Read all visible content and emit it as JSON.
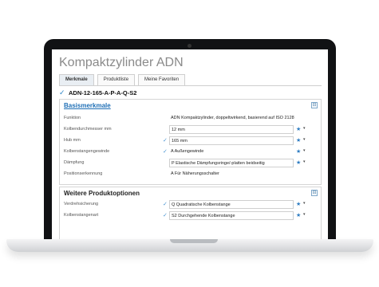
{
  "app": {
    "title": "Kompaktzylinder ADN"
  },
  "tabs": [
    {
      "label": "Merkmale"
    },
    {
      "label": "Produktliste"
    },
    {
      "label": "Meine Favoriten"
    }
  ],
  "product_code": "ADN-12-165-A-P-A-Q-S2",
  "sections": {
    "basis": {
      "title": "Basismerkmale",
      "collapse_symbol": "⊟",
      "rows": [
        {
          "label": "Funktion",
          "value": "ADN Kompaktzylinder, doppeltwirkend, basierend auf ISO 2128"
        },
        {
          "label": "Kolbendurchmesser mm",
          "value": "12 mm"
        },
        {
          "label": "Hub mm",
          "value": "165 mm"
        },
        {
          "label": "Kolbenstangengewinde",
          "value": "A Außengewinde"
        },
        {
          "label": "Dämpfung",
          "value": "P Elastische Dämpfungsringe/-platten beidseitig"
        },
        {
          "label": "Positionserkennung",
          "value": "A Für Näherungsschalter"
        }
      ]
    },
    "weitere": {
      "title": "Weitere Produktoptionen",
      "collapse_symbol": "⊟",
      "rows": [
        {
          "label": "Verdrehsicherung",
          "value": "Q Quadratische Kolbenstange"
        },
        {
          "label": "Kolbenstangenart",
          "value": "S2 Durchgehende Kolbenstange"
        }
      ]
    }
  },
  "icons": {
    "check": "✓",
    "star": "★",
    "dropdown": "▾"
  },
  "colors": {
    "accent": "#2f7dc2",
    "link": "#1f6fb6"
  }
}
